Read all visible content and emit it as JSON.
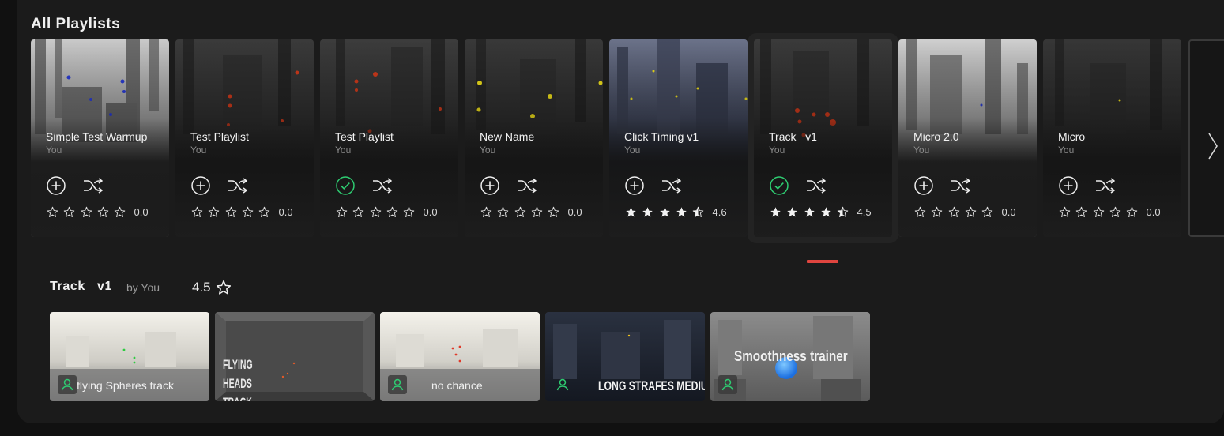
{
  "section": {
    "title": "All Playlists"
  },
  "colors": {
    "accent_green": "#2ecc71",
    "indicator_red": "#e0453f"
  },
  "playlists": [
    {
      "name": "Simple Test Warmup",
      "owner": "You",
      "added": false,
      "stars": 0,
      "rating": "0.0"
    },
    {
      "name": "Test Playlist",
      "owner": "You",
      "added": false,
      "stars": 0,
      "rating": "0.0"
    },
    {
      "name": "Test Playlist",
      "owner": "You",
      "added": true,
      "stars": 0,
      "rating": "0.0"
    },
    {
      "name": "New Name",
      "owner": "You",
      "added": false,
      "stars": 0,
      "rating": "0.0"
    },
    {
      "name": "Click Timing v1",
      "owner": "You",
      "added": false,
      "stars": 4.6,
      "rating": "4.6"
    },
    {
      "name": "Track   v1",
      "owner": "You",
      "added": true,
      "stars": 4.5,
      "rating": "4.5"
    },
    {
      "name": "Micro 2.0",
      "owner": "You",
      "added": false,
      "stars": 0,
      "rating": "0.0"
    },
    {
      "name": "Micro",
      "owner": "You",
      "added": false,
      "stars": 0,
      "rating": "0.0"
    }
  ],
  "icons": {
    "add": "plus-circle-icon",
    "added": "check-circle-icon",
    "shuffle": "shuffle-icon",
    "star": "star-icon",
    "next": "chevron-right-icon",
    "creator": "person-icon"
  },
  "selected": {
    "title": "Track   v1",
    "by": "by You",
    "rating": "4.5",
    "tasks": [
      {
        "name": "flying Spheres track",
        "art_text": ""
      },
      {
        "name": "",
        "art_text": "FLYING HEADS TRACK SMALL"
      },
      {
        "name": "no chance",
        "art_text": ""
      },
      {
        "name": "",
        "art_text": "LONG STRAFES MEDIUM"
      },
      {
        "name": "",
        "art_text": "Smoothness trainer"
      }
    ]
  }
}
